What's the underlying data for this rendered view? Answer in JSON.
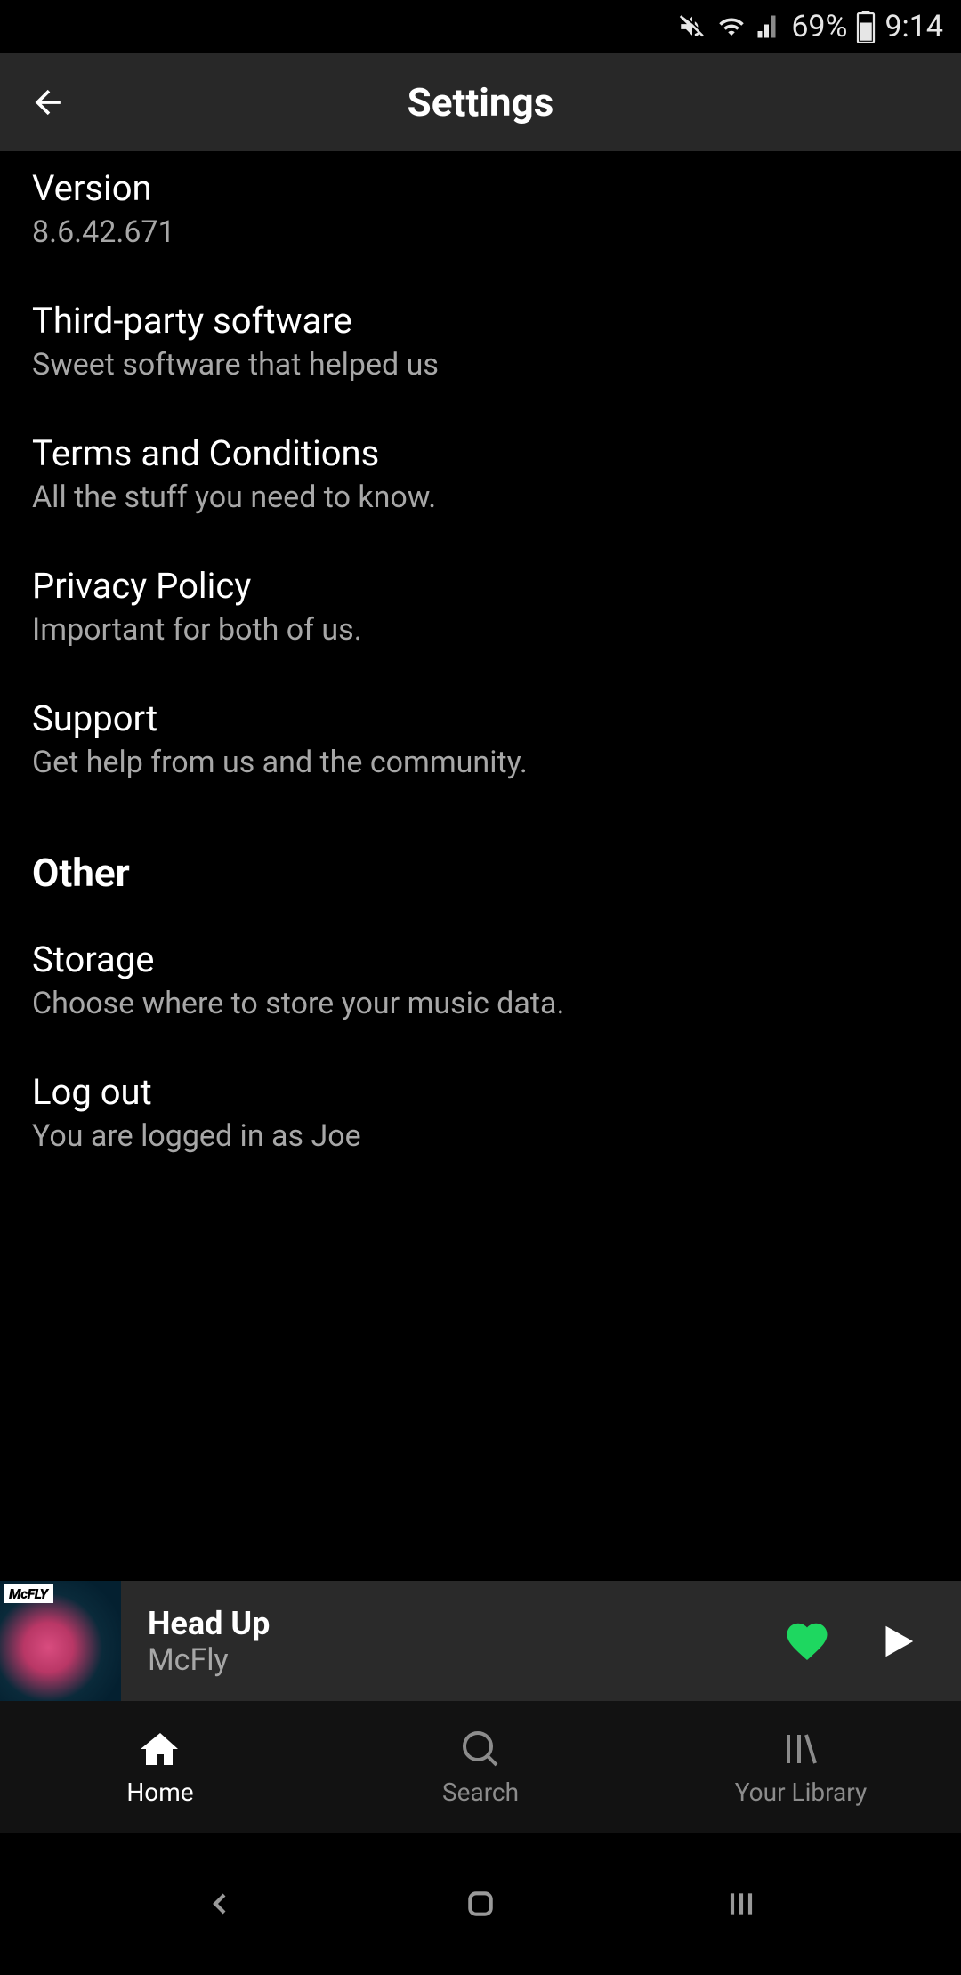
{
  "status_bar": {
    "battery_percent": "69%",
    "time": "9:14"
  },
  "header": {
    "title": "Settings"
  },
  "settings": [
    {
      "title": "Version",
      "subtitle": "8.6.42.671"
    },
    {
      "title": "Third-party software",
      "subtitle": "Sweet software that helped us"
    },
    {
      "title": "Terms and Conditions",
      "subtitle": "All the stuff you need to know."
    },
    {
      "title": "Privacy Policy",
      "subtitle": "Important for both of us."
    },
    {
      "title": "Support",
      "subtitle": "Get help from us and the community."
    }
  ],
  "section_header": "Other",
  "other_settings": [
    {
      "title": "Storage",
      "subtitle": "Choose where to store your music data."
    },
    {
      "title": "Log out",
      "subtitle": "You are logged in as Joe"
    }
  ],
  "now_playing": {
    "title": "Head Up",
    "artist": "McFly",
    "liked": true
  },
  "bottom_nav": [
    {
      "label": "Home",
      "icon": "home-icon",
      "active": true
    },
    {
      "label": "Search",
      "icon": "search-icon",
      "active": false
    },
    {
      "label": "Your Library",
      "icon": "library-icon",
      "active": false
    }
  ]
}
